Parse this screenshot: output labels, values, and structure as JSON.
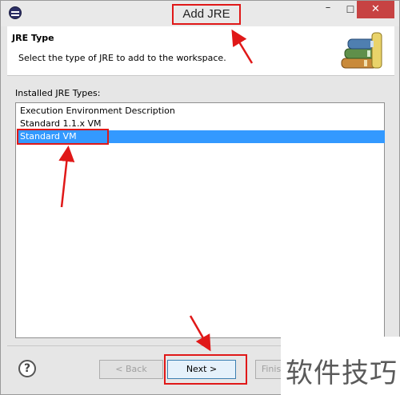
{
  "window": {
    "title": "Add JRE",
    "controls": {
      "minimize": "–",
      "maximize": "☐",
      "close": "✕"
    }
  },
  "header": {
    "title": "JRE Type",
    "description": "Select the type of JRE to add to the workspace.",
    "icon": "books-icon"
  },
  "list": {
    "label": "Installed JRE Types:",
    "items": [
      {
        "label": "Execution Environment Description",
        "selected": false
      },
      {
        "label": "Standard 1.1.x VM",
        "selected": false
      },
      {
        "label": "Standard VM",
        "selected": true
      }
    ]
  },
  "footer": {
    "help_glyph": "?",
    "back_label": "< Back",
    "next_label": "Next >",
    "finish_label": "Finis"
  },
  "watermark": {
    "text": "软件技巧"
  },
  "colors": {
    "annotation": "#e01818",
    "selection": "#3399ff",
    "close": "#c74343"
  }
}
